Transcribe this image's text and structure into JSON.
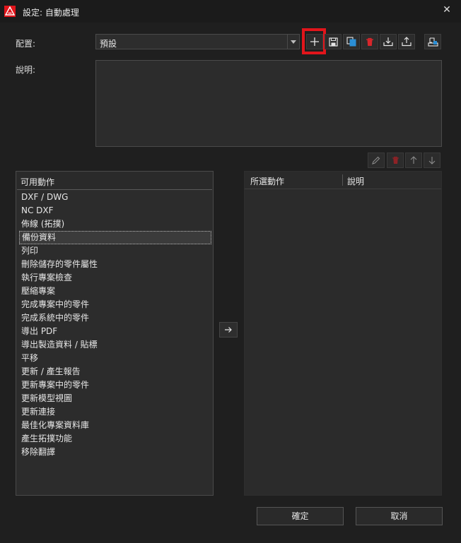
{
  "window": {
    "title": "設定: 自動處理",
    "close_symbol": "✕"
  },
  "config": {
    "label": "配置:",
    "selected": "預設"
  },
  "description": {
    "label": "說明:",
    "value": ""
  },
  "toolbar": {
    "icons": [
      "plus-icon",
      "save-icon",
      "copy-icon",
      "delete-icon",
      "import-icon",
      "export-icon",
      "settings-export-icon"
    ],
    "highlighted": "plus-icon",
    "highlight_color": "#e2151b"
  },
  "available_actions": {
    "header": "可用動作",
    "selected_index": 3,
    "items": [
      "DXF / DWG",
      "NC DXF",
      "佈線 (拓撲)",
      "備份資料",
      "列印",
      "刪除儲存的零件屬性",
      "執行專案檢查",
      "壓縮專案",
      "完成專案中的零件",
      "完成系統中的零件",
      "導出 PDF",
      "導出製造資料 / 貼標",
      "平移",
      "更新 / 產生報告",
      "更新專案中的零件",
      "更新模型視圖",
      "更新連接",
      "最佳化專案資料庫",
      "產生拓撲功能",
      "移除翻譯"
    ]
  },
  "selected_actions": {
    "col1": "所選動作",
    "col2": "說明",
    "rows": []
  },
  "buttons": {
    "ok": "確定",
    "cancel": "取消"
  }
}
